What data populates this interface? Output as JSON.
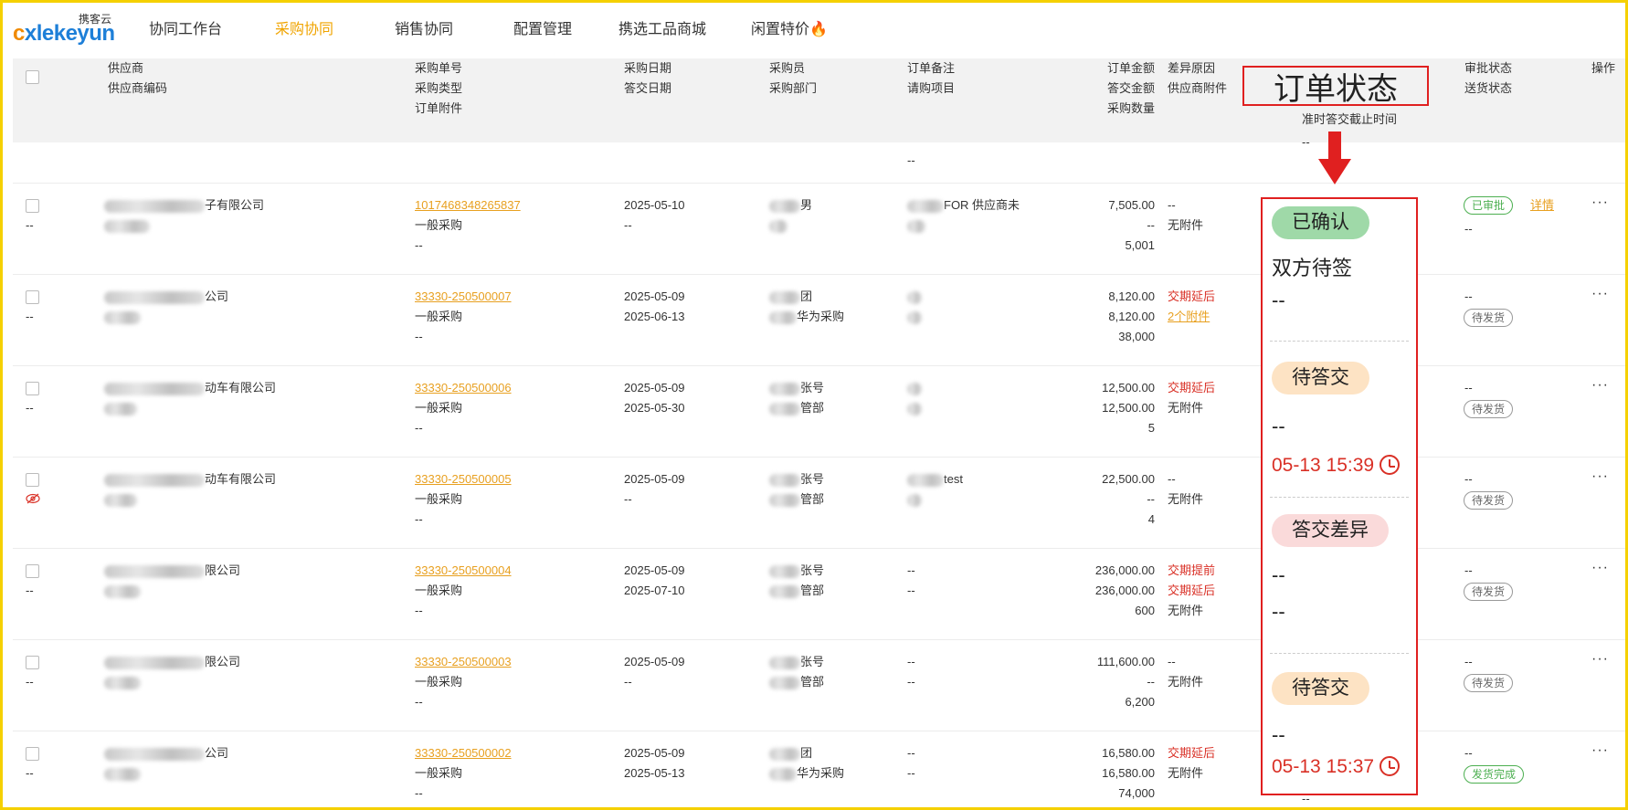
{
  "brand": {
    "logo_text_cn": "携客云",
    "logo_text_en": "xlekeyun"
  },
  "nav": {
    "items": [
      {
        "label": "协同工作台",
        "active": false
      },
      {
        "label": "采购协同",
        "active": true
      },
      {
        "label": "销售协同",
        "active": false
      },
      {
        "label": "配置管理",
        "active": false
      },
      {
        "label": "携选工品商城",
        "active": false
      },
      {
        "label": "闲置特价",
        "active": false
      }
    ]
  },
  "table": {
    "headers": {
      "supplier": [
        "供应商",
        "供应商编码"
      ],
      "po": [
        "采购单号",
        "采购类型",
        "订单附件"
      ],
      "date": [
        "采购日期",
        "答交日期"
      ],
      "buyer": [
        "采购员",
        "采购部门"
      ],
      "remark": [
        "订单备注",
        "请购项目"
      ],
      "amount": [
        "订单金额",
        "答交金额",
        "采购数量"
      ],
      "diff": [
        "差异原因",
        "供应商附件"
      ],
      "order_status": "订单状态",
      "deadline": "准时答交截止时间",
      "approval": [
        "审批状态",
        "送货状态"
      ],
      "action": "操作"
    },
    "rows": [
      {
        "supplier": "子有限公司",
        "code": "--",
        "po_no": "1017468348265837",
        "po_type": "一般采购",
        "attachment": "--",
        "po_date": "2025-05-10",
        "reply_date": "--",
        "buyer": "男",
        "dept": "",
        "remark": "FOR 供应商未",
        "project": "",
        "amount": "7,505.00",
        "reply_amount": "--",
        "qty": "5,001",
        "diff": "--",
        "supplier_attach": "无附件",
        "approval": "已审批",
        "approval_link": "详情",
        "delivery": "--"
      },
      {
        "supplier": "公司",
        "code": "--",
        "po_no": "33330-250500007",
        "po_type": "一般采购",
        "attachment": "--",
        "po_date": "2025-05-09",
        "reply_date": "2025-06-13",
        "buyer": "团",
        "dept": "华为采购",
        "remark": "",
        "project": "",
        "amount": "8,120.00",
        "reply_amount": "8,120.00",
        "qty": "38,000",
        "diff": "交期延后",
        "supplier_attach": "2个附件",
        "approval": "--",
        "delivery": "待发货"
      },
      {
        "supplier": "动车有限公司",
        "code": "--",
        "po_no": "33330-250500006",
        "po_type": "一般采购",
        "attachment": "--",
        "po_date": "2025-05-09",
        "reply_date": "2025-05-30",
        "buyer": "张号",
        "dept": "管部",
        "remark": "",
        "project": "",
        "amount": "12,500.00",
        "reply_amount": "12,500.00",
        "qty": "5",
        "diff": "交期延后",
        "supplier_attach": "无附件",
        "approval": "--",
        "delivery": "待发货"
      },
      {
        "supplier": "动车有限公司",
        "code": "",
        "po_no": "33330-250500005",
        "po_type": "一般采购",
        "attachment": "--",
        "po_date": "2025-05-09",
        "reply_date": "--",
        "buyer": "张号",
        "dept": "管部",
        "remark": "test",
        "project": "",
        "amount": "22,500.00",
        "reply_amount": "--",
        "qty": "4",
        "diff": "--",
        "supplier_attach": "无附件",
        "approval": "--",
        "delivery": "待发货"
      },
      {
        "supplier": "限公司",
        "code": "--",
        "po_no": "33330-250500004",
        "po_type": "一般采购",
        "attachment": "--",
        "po_date": "2025-05-09",
        "reply_date": "2025-07-10",
        "buyer": "张号",
        "dept": "管部",
        "remark": "--",
        "project": "--",
        "amount": "236,000.00",
        "reply_amount": "236,000.00",
        "qty": "600",
        "diff": "交期提前",
        "diff2": "交期延后",
        "supplier_attach": "无附件",
        "approval": "--",
        "delivery": "待发货"
      },
      {
        "supplier": "限公司",
        "code": "--",
        "po_no": "33330-250500003",
        "po_type": "一般采购",
        "attachment": "--",
        "po_date": "2025-05-09",
        "reply_date": "--",
        "buyer": "张号",
        "dept": "管部",
        "remark": "--",
        "project": "--",
        "amount": "111,600.00",
        "reply_amount": "--",
        "qty": "6,200",
        "diff": "--",
        "supplier_attach": "无附件",
        "approval": "--",
        "delivery": "待发货"
      },
      {
        "supplier": "公司",
        "code": "--",
        "po_no": "33330-250500002",
        "po_type": "一般采购",
        "attachment": "--",
        "po_date": "2025-05-09",
        "reply_date": "2025-05-13",
        "buyer": "团",
        "dept": "华为采购",
        "remark": "--",
        "project": "--",
        "amount": "16,580.00",
        "reply_amount": "16,580.00",
        "qty": "74,000",
        "diff": "交期延后",
        "supplier_attach": "无附件",
        "approval": "--",
        "delivery": "发货完成"
      }
    ],
    "top_partial": {
      "remark": "--",
      "deadline": "--"
    },
    "bottom_partial": {
      "deadline": "--"
    }
  },
  "status_panel": {
    "segments": [
      {
        "pill": "已确认",
        "pill_color": "green",
        "line1": "双方待签",
        "line2": "--"
      },
      {
        "pill": "待答交",
        "pill_color": "peach",
        "line1": "--",
        "time": "05-13 15:39"
      },
      {
        "pill": "答交差异",
        "pill_color": "pink",
        "line1": "--",
        "line2": "--"
      },
      {
        "pill": "待答交",
        "pill_color": "peach",
        "line1": "--",
        "time": "05-13 15:37"
      }
    ]
  },
  "colors": {
    "accent": "#f0a400",
    "link": "#e8a020",
    "alert": "#d93026",
    "highlight_border": "#e02020",
    "frame": "#f5d000"
  },
  "icons": {
    "more": "more-icon",
    "clock": "clock-icon",
    "hidden": "eye-off-icon",
    "fire": "fire-icon"
  }
}
